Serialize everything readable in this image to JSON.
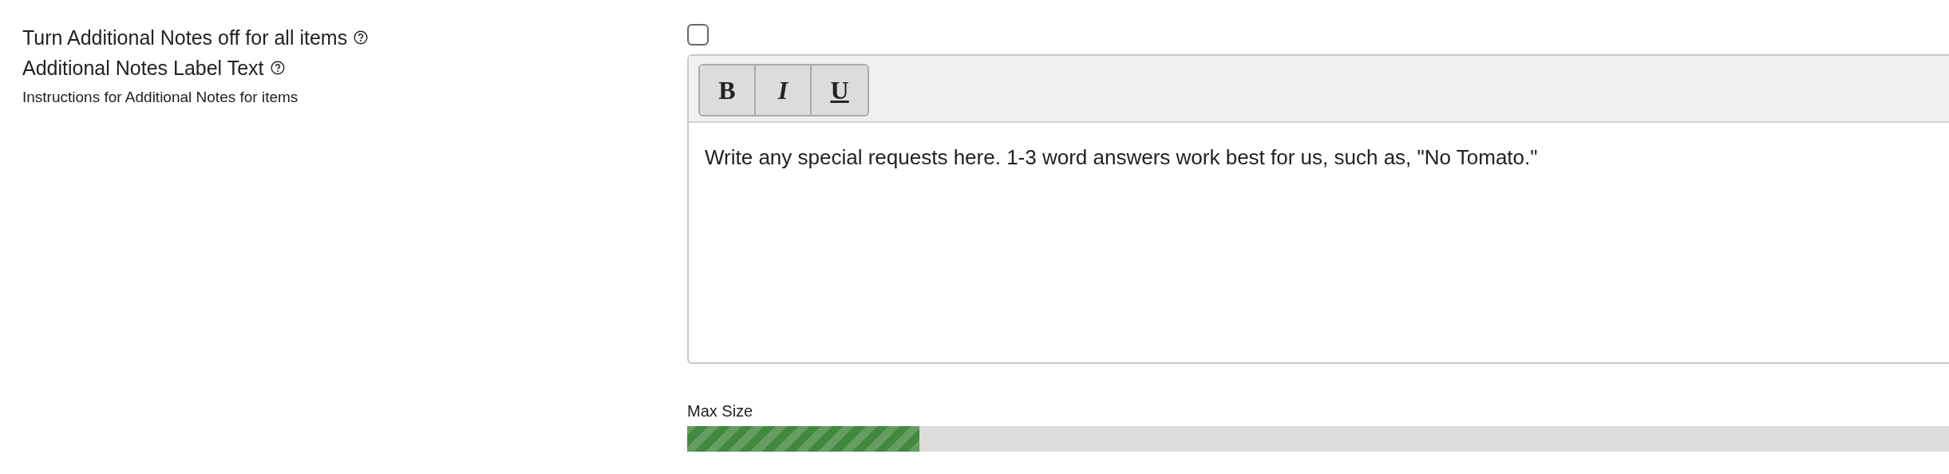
{
  "settings": [
    {
      "kind": "checkbox",
      "label": "Turn Additional Notes off for all items",
      "help": true,
      "checked": false
    },
    {
      "kind": "editor",
      "label": "Additional Notes Label Text",
      "help": true,
      "description": "Instructions for Additional Notes for items",
      "toolbar": [
        {
          "kind": "bold",
          "label": "B"
        },
        {
          "kind": "italic",
          "label": "I"
        },
        {
          "kind": "underline",
          "label": "U"
        }
      ],
      "value": "Write any special requests here. 1-3 word answers work best for us, such as, \"No Tomato.\""
    }
  ],
  "max_size": {
    "label": "Max Size",
    "level": 0.18
  }
}
